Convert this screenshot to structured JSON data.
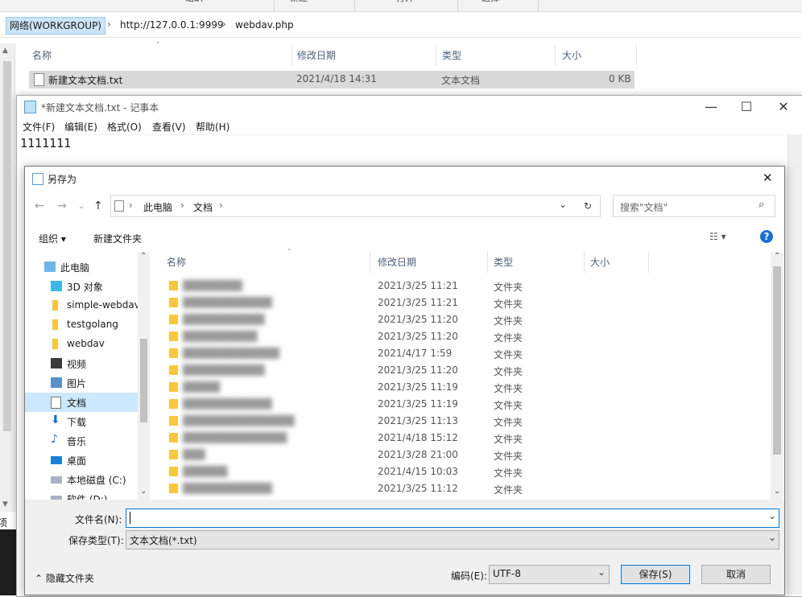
{
  "explorer": {
    "ribbon": [
      "组织",
      "新建",
      "打开",
      "选择"
    ],
    "breadcrumb": [
      "网络(WORKGROUP)",
      "http://127.0.0.1:9999",
      "webdav.php"
    ],
    "columns": [
      "名称",
      "修改日期",
      "类型",
      "大小"
    ],
    "file": {
      "name": "新建文本文档.txt",
      "date": "2021/4/18 14:31",
      "type": "文本文档",
      "size": "0 KB"
    },
    "side_text": "项目"
  },
  "notepad": {
    "title": "*新建文本文档.txt - 记事本",
    "menu": [
      "文件(F)",
      "编辑(E)",
      "格式(O)",
      "查看(V)",
      "帮助(H)"
    ],
    "content": "1111111",
    "controls": {
      "minimize": "—",
      "maximize": "☐",
      "close": "✕"
    }
  },
  "dialog": {
    "title": "另存为",
    "close": "✕",
    "breadcrumb": [
      "此电脑",
      "文档"
    ],
    "search_placeholder": "搜索\"文档\"",
    "toolbar": {
      "organize": "组织",
      "new_folder": "新建文件夹",
      "help": "?"
    },
    "tree": [
      {
        "label": "此电脑",
        "icon": "pc-icon"
      },
      {
        "label": "3D 对象",
        "icon": "3d-objects-icon"
      },
      {
        "label": "simple-webdav",
        "icon": "folder-icon"
      },
      {
        "label": "testgolang",
        "icon": "folder-icon"
      },
      {
        "label": "webdav",
        "icon": "folder-icon"
      },
      {
        "label": "视频",
        "icon": "video-icon"
      },
      {
        "label": "图片",
        "icon": "pictures-icon"
      },
      {
        "label": "文档",
        "icon": "documents-icon"
      },
      {
        "label": "下载",
        "icon": "download-icon"
      },
      {
        "label": "音乐",
        "icon": "music-icon"
      },
      {
        "label": "桌面",
        "icon": "desktop-icon"
      },
      {
        "label": "本地磁盘 (C:)",
        "icon": "drive-icon"
      },
      {
        "label": "软件 (D:)",
        "icon": "drive-icon"
      }
    ],
    "columns": [
      "名称",
      "修改日期",
      "类型",
      "大小"
    ],
    "rows": [
      {
        "date": "2021/3/25 11:21",
        "type": "文件夹"
      },
      {
        "date": "2021/3/25 11:21",
        "type": "文件夹"
      },
      {
        "date": "2021/3/25 11:20",
        "type": "文件夹"
      },
      {
        "date": "2021/3/25 11:20",
        "type": "文件夹"
      },
      {
        "date": "2021/4/17 1:59",
        "type": "文件夹"
      },
      {
        "date": "2021/3/25 11:20",
        "type": "文件夹"
      },
      {
        "date": "2021/3/25 11:19",
        "type": "文件夹"
      },
      {
        "date": "2021/3/25 11:19",
        "type": "文件夹"
      },
      {
        "date": "2021/3/25 11:13",
        "type": "文件夹"
      },
      {
        "date": "2021/4/18 15:12",
        "type": "文件夹"
      },
      {
        "date": "2021/3/28 21:00",
        "type": "文件夹"
      },
      {
        "date": "2021/4/15 10:03",
        "type": "文件夹"
      },
      {
        "date": "2021/3/25 11:12",
        "type": "文件夹"
      }
    ],
    "filename_label": "文件名(N):",
    "filename_value": "",
    "filetype_label": "保存类型(T):",
    "filetype_value": "文本文档(*.txt)",
    "hide_folders": "隐藏文件夹",
    "encoding_label": "编码(E):",
    "encoding_value": "UTF-8",
    "save": "保存(S)",
    "cancel": "取消"
  }
}
